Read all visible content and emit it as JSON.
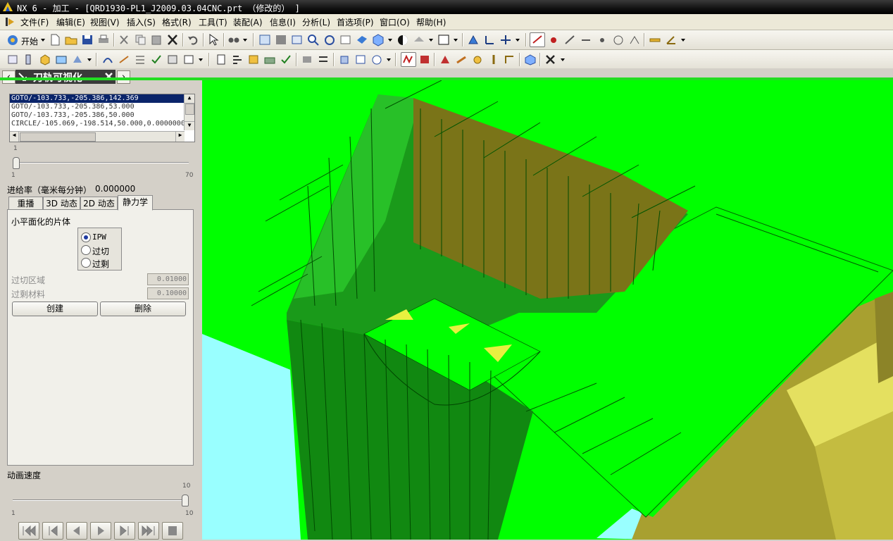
{
  "window": {
    "title": "NX 6 - 加工 - [QRD1930-PL1_J2009.03.04CNC.prt （修改的） ]"
  },
  "menu": [
    "文件(F)",
    "编辑(E)",
    "视图(V)",
    "插入(S)",
    "格式(R)",
    "工具(T)",
    "装配(A)",
    "信息(I)",
    "分析(L)",
    "首选项(P)",
    "窗口(O)",
    "帮助(H)"
  ],
  "toolbar": {
    "start_label": "开始"
  },
  "panel": {
    "title": "刀轨可视化",
    "list_items": [
      "GOTO/-103.733,-205.386,142.369",
      "GOTO/-103.733,-205.386,53.000",
      "GOTO/-103.733,-205.386,50.000",
      "CIRCLE/-105.069,-198.514,50.000,0.0000000"
    ],
    "slider1": {
      "value": "1",
      "min": "1",
      "max": "70",
      "fraction": 0.0
    },
    "feed_rate_label": "进给率（毫米每分钟）",
    "feed_rate_value": "0.000000",
    "tabs": [
      "重播",
      "3D 动态",
      "2D 动态",
      "静力学"
    ],
    "active_tab": "静力学",
    "group_label": "小平面化的片体",
    "radios": [
      "IPW",
      "过切",
      "过剩"
    ],
    "selected_radio": "IPW",
    "overcut_area_label": "过切区域",
    "overcut_area_value": "0.01000",
    "excess_material_label": "过剩材料",
    "excess_material_value": "0.10000",
    "create_label": "创建",
    "delete_label": "删除",
    "anim_speed_label": "动画速度",
    "speed": {
      "value": "10",
      "min": "1",
      "max": "10",
      "fraction": 1.0
    }
  },
  "colors": {
    "stock_green": "#00ff00",
    "wall_dark": "#008800",
    "part_olive": "#a8a030",
    "background_cyan": "#99ffff"
  }
}
